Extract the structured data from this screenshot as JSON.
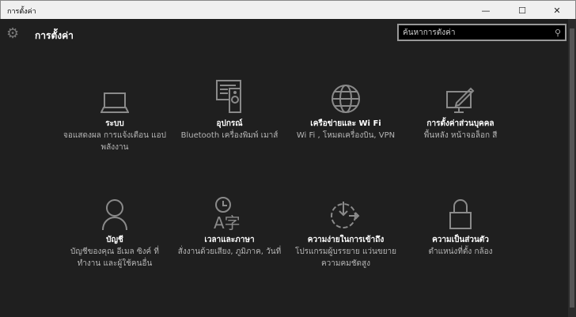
{
  "window": {
    "title": "การตั้งค่า",
    "minimize": "—",
    "maximize": "☐",
    "close": "✕"
  },
  "header": {
    "title": "การตั้งค่า",
    "search_placeholder": "ค้นหาการตั้งค่า"
  },
  "tiles": [
    {
      "icon": "laptop-icon",
      "title": "ระบบ",
      "desc": "จอแสดงผล การแจ้งเตือน แอป พลังงาน"
    },
    {
      "icon": "devices-icon",
      "title": "อุปกรณ์",
      "desc": "Bluetooth เครื่องพิมพ์ เมาส์"
    },
    {
      "icon": "globe-icon",
      "title": "เครือข่ายและ Wi Fi",
      "desc": "Wi Fi , โหมดเครื่องบิน, VPN"
    },
    {
      "icon": "personalization-icon",
      "title": "การตั้งค่าส่วนบุคคล",
      "desc": "พื้นหลัง หน้าจอล็อก สี"
    },
    {
      "icon": "person-icon",
      "title": "บัญชี",
      "desc": "บัญชีของคุณ อีเมล ซิงค์ ที่ทำงาน และผู้ใช้คนอื่น"
    },
    {
      "icon": "time-language-icon",
      "title": "เวลาและภาษา",
      "desc": "สั่งงานด้วยเสียง, ภูมิภาค, วันที่"
    },
    {
      "icon": "ease-of-access-icon",
      "title": "ความง่ายในการเข้าถึง",
      "desc": "โปรแกรมผู้บรรยาย แว่นขยาย ความคมชัดสูง"
    },
    {
      "icon": "lock-icon",
      "title": "ความเป็นส่วนตัว",
      "desc": "ตำแหน่งที่ตั้ง กล้อง"
    }
  ]
}
